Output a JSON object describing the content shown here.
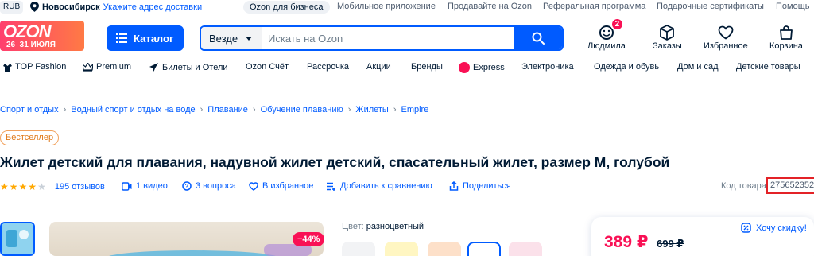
{
  "topbar": {
    "currency": "RUB",
    "city": "Новосибирск",
    "delivery_link": "Укажите адрес доставки",
    "business": "Ozon для бизнеса",
    "links": [
      "Мобильное приложение",
      "Продавайте на Ozon",
      "Реферальная программа",
      "Подарочные сертификаты",
      "Помощь"
    ]
  },
  "header": {
    "logo_text": "OZON",
    "logo_dates": "26–31 ИЮЛЯ",
    "catalog_label": "Каталог",
    "search_scope": "Везде",
    "search_placeholder": "Искать на Ozon",
    "user_label": "Людмила",
    "user_badge": "2",
    "orders_label": "Заказы",
    "favorites_label": "Избранное",
    "cart_label": "Корзина"
  },
  "nav": [
    "TOP Fashion",
    "Premium",
    "Билеты и Отели",
    "Ozon Счёт",
    "Рассрочка",
    "Акции",
    "Бренды",
    "Express",
    "Электроника",
    "Одежда и обувь",
    "Дом и сад",
    "Детские товары"
  ],
  "breadcrumbs": [
    "Спорт и отдых",
    "Водный спорт и отдых на воде",
    "Плавание",
    "Обучение плаванию",
    "Жилеты",
    "Empire"
  ],
  "product": {
    "badge": "Бестселлер",
    "title": "Жилет детский для плавания, надувной жилет детский, спасательный жилет, размер M, голубой",
    "rating": 4.5,
    "reviews": "195 отзывов",
    "video": "1 видео",
    "questions": "3 вопроса",
    "favorite": "В избранное",
    "compare": "Добавить к сравнению",
    "share": "Поделиться",
    "code_label": "Код товара",
    "code_value": "275652352",
    "discount": "−44%",
    "color_label": "Цвет:",
    "color_value": "разноцветный",
    "price": "389 ₽",
    "old_price": "699 ₽",
    "want_cheaper": "Хочу скидку!"
  },
  "colors": {
    "accent": "#005bff",
    "sale": "#f91155",
    "highlight": "#e32227"
  }
}
